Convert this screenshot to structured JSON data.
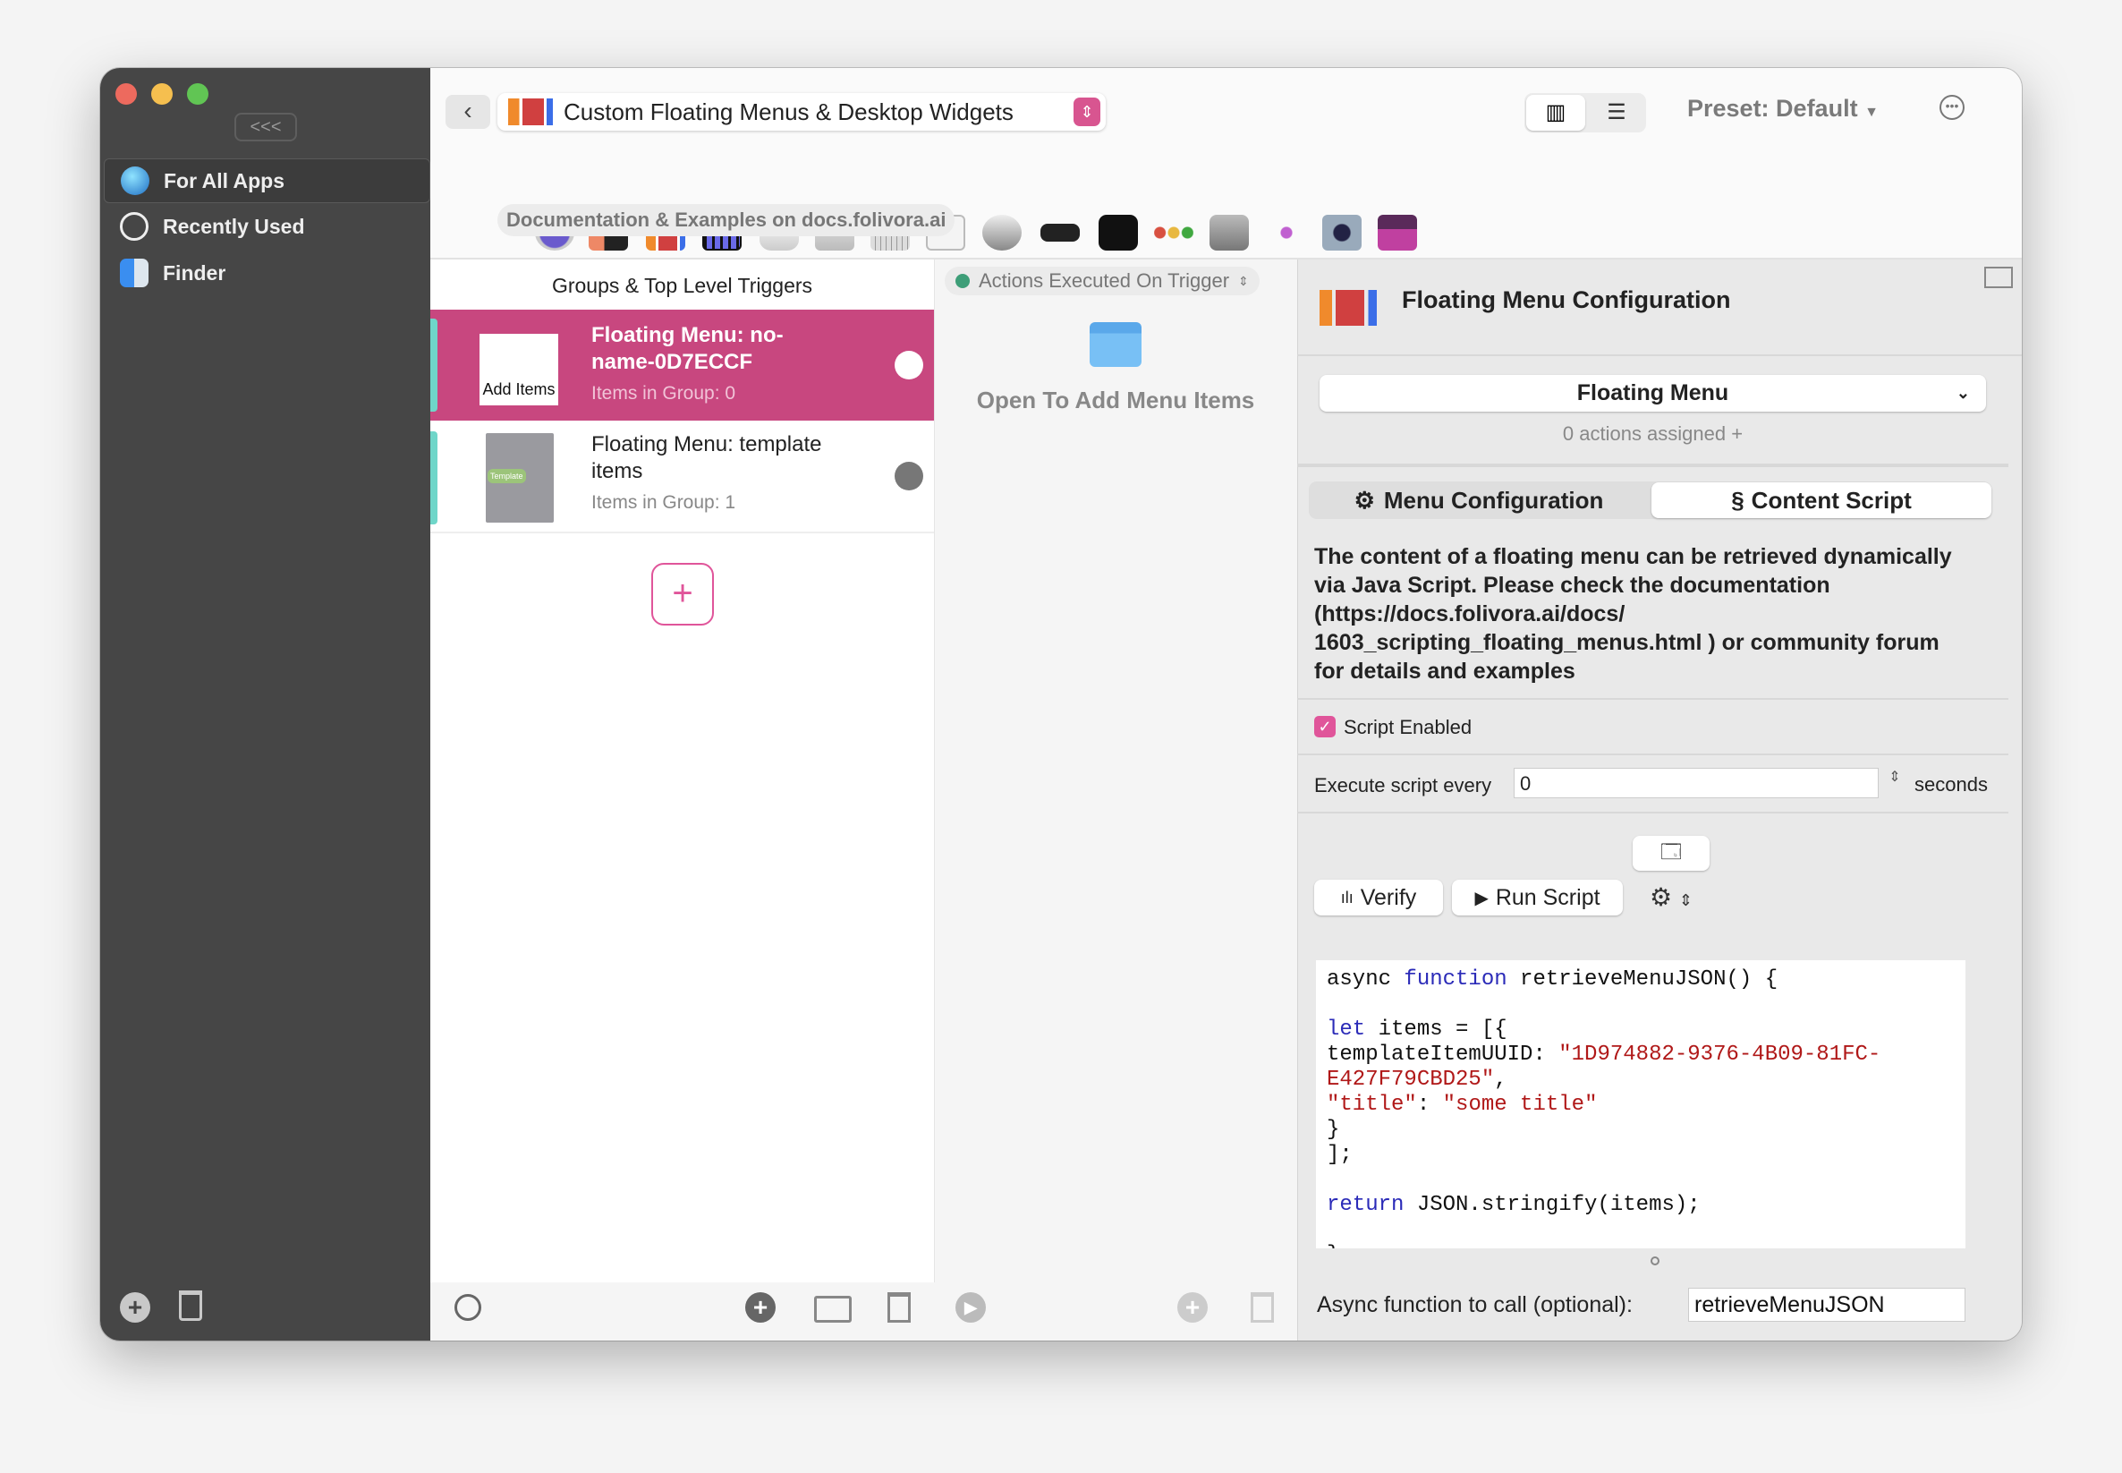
{
  "window": {
    "traffic_lights": {
      "close": "#ed6a5e",
      "minimize": "#f5bf4f",
      "zoom": "#61c554"
    }
  },
  "sidebar": {
    "collapse_label": "<<<",
    "items": [
      {
        "label": "For All Apps",
        "icon": "globe-icon"
      },
      {
        "label": "Recently Used",
        "icon": "clock-icon"
      },
      {
        "label": "Finder",
        "icon": "finder-icon"
      }
    ]
  },
  "toolbar": {
    "back_icon": "chevron-left-icon",
    "trigger_type": "Custom Floating Menus & Desktop Widgets",
    "preset": "Preset: Default",
    "docs_link": "Documentation & Examples on docs.folivora.ai",
    "trigger_icons": [
      "chip-icon",
      "touchbar-icon",
      "floating-menu-icon",
      "streamdeck-icon",
      "magic-mouse-icon",
      "trackpad-icon",
      "keyboard-icon",
      "key-sequence-icon",
      "mouse-icon",
      "remote-icon",
      "notch-icon",
      "traffic-lights-icon",
      "midi-icon",
      "drawing-icon",
      "siri-remote-icon",
      "other-icon"
    ]
  },
  "groups": {
    "header": "Groups & Top Level Triggers",
    "items": [
      {
        "title": "Floating Menu: no-name-0D7ECCF",
        "subtitle": "Items in Group: 0",
        "thumb_label": "Add Items",
        "selected": true
      },
      {
        "title": "Floating Menu: template items",
        "subtitle": "Items in Group: 1",
        "thumb_label": "Template",
        "selected": false
      }
    ]
  },
  "actions": {
    "header": "Actions Executed On Trigger",
    "empty_label": "Open To Add Menu Items"
  },
  "config": {
    "title": "Floating Menu Configuration",
    "dropdown": "Floating Menu",
    "actions_assigned": "0 actions assigned +",
    "tabs": [
      {
        "label": "Menu Configuration",
        "active": false
      },
      {
        "label": "Content Script",
        "active": true
      }
    ],
    "description": "The content of a floating menu can be retrieved dynamically via Java Script. Please check the documentation (https://docs.folivora.ai/docs/ 1603_scripting_floating_menus.html ) or community forum for details and examples",
    "script_enabled_label": "Script Enabled",
    "script_enabled": true,
    "execute_label": "Execute script every",
    "execute_value": "0",
    "seconds_label": "seconds",
    "verify_label": "Verify",
    "run_label": "Run Script",
    "code": {
      "l1a": "async ",
      "l1b": "function",
      "l1c": " retrieveMenuJSON() {",
      "l3a": "let",
      "l3b": " items = [{",
      "l4a": "templateItemUUID: ",
      "l4b": "\"1D974882-9376-4B09-81FC-",
      "l5a": "E427F79CBD25\"",
      "l5b": ",",
      "l6a": "\"title\"",
      "l6b": ": ",
      "l6c": "\"some title\"",
      "l7": "}",
      "l8": "];",
      "l10a": "return",
      "l10b": " JSON.stringify(items);",
      "l12": "}"
    },
    "async_label": "Async function to call (optional):",
    "async_value": "retrieveMenuJSON"
  },
  "colors": {
    "accent": "#c8477f",
    "sidebar": "#464646"
  }
}
